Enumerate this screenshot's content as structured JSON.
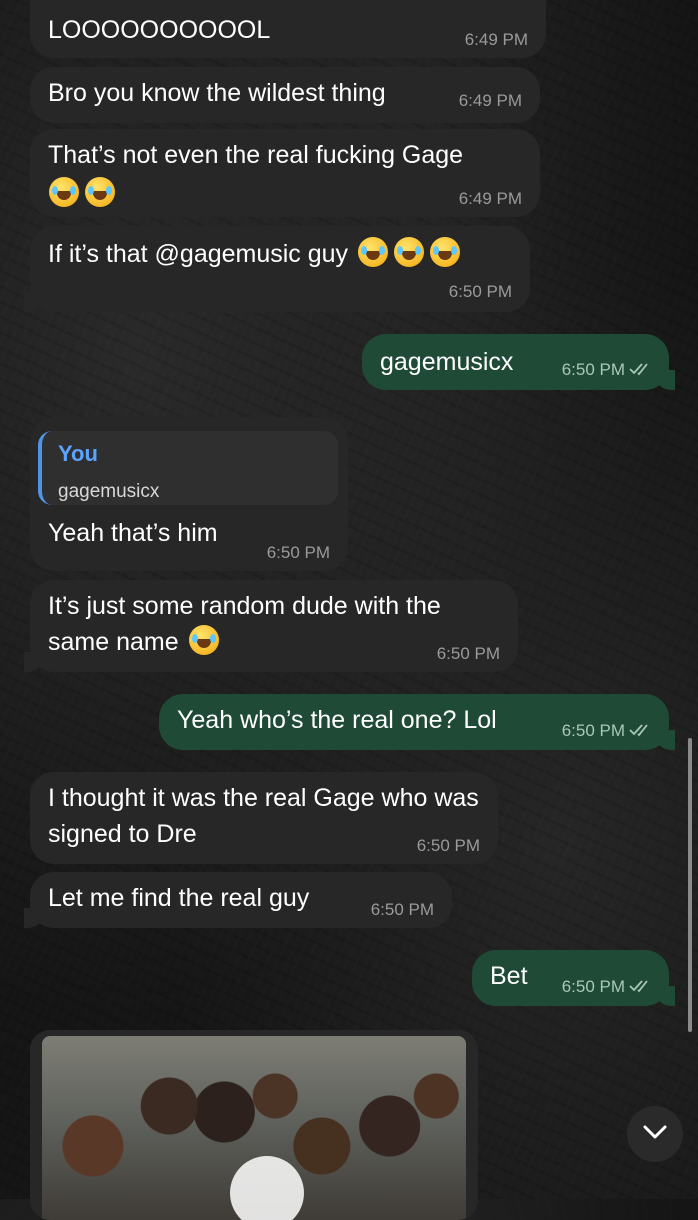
{
  "messages": [
    {
      "id": "m1",
      "dir": "in",
      "text": "LOOOOOOOOOOL",
      "time": "6:49 PM"
    },
    {
      "id": "m2",
      "dir": "in",
      "text": "Bro you know the wildest thing",
      "time": "6:49 PM"
    },
    {
      "id": "m3",
      "dir": "in",
      "text": "That’s not even the real fucking Gage",
      "time": "6:49 PM",
      "emoji_count": 2
    },
    {
      "id": "m4",
      "dir": "in",
      "text": "If it’s that @gagemusic guy",
      "time": "6:50 PM",
      "emoji_count": 3
    },
    {
      "id": "m5",
      "dir": "out",
      "text": "gagemusicx",
      "time": "6:50 PM"
    },
    {
      "id": "m6",
      "dir": "in",
      "reply": {
        "name": "You",
        "text": "gagemusicx"
      },
      "text": "Yeah that’s him",
      "time": "6:50 PM"
    },
    {
      "id": "m7",
      "dir": "in",
      "text": "It’s just some random dude with the same name",
      "time": "6:50 PM",
      "emoji_count": 1
    },
    {
      "id": "m8",
      "dir": "out",
      "text": "Yeah who’s the real one? Lol",
      "time": "6:50 PM"
    },
    {
      "id": "m9",
      "dir": "in",
      "text": "I thought it was the real Gage who was signed to Dre",
      "time": "6:50 PM"
    },
    {
      "id": "m10",
      "dir": "in",
      "text": "Let me find the real guy",
      "time": "6:50 PM"
    },
    {
      "id": "m11",
      "dir": "out",
      "text": "Bet",
      "time": "6:50 PM"
    }
  ],
  "icons": {
    "emoji": "face-with-tears-of-joy-icon",
    "read_receipt": "double-check-icon",
    "play": "play-icon",
    "scroll_down": "chevron-down-icon"
  },
  "colors": {
    "incoming_bubble": "#272727",
    "outgoing_bubble": "#1f4a35",
    "reply_accent": "#4e95e6"
  }
}
